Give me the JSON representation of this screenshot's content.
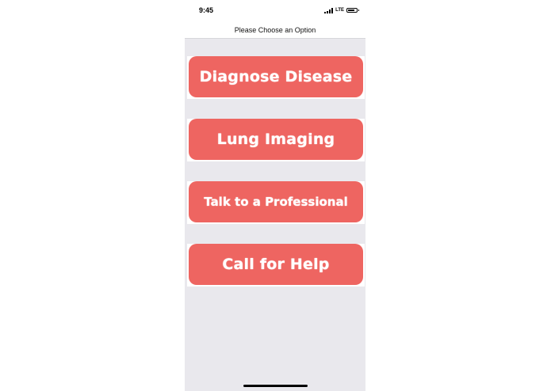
{
  "status_bar": {
    "time": "9:45",
    "network": "LTE",
    "battery_level": 0.8
  },
  "nav": {
    "title": "Please Choose an Option"
  },
  "options": [
    {
      "label": "Diagnose Disease"
    },
    {
      "label": "Lung Imaging"
    },
    {
      "label": "Talk to a Professional"
    },
    {
      "label": "Call for Help"
    }
  ],
  "colors": {
    "button_background": "#ee6561",
    "button_text": "#ffffff",
    "content_background": "#e9e8ed"
  }
}
